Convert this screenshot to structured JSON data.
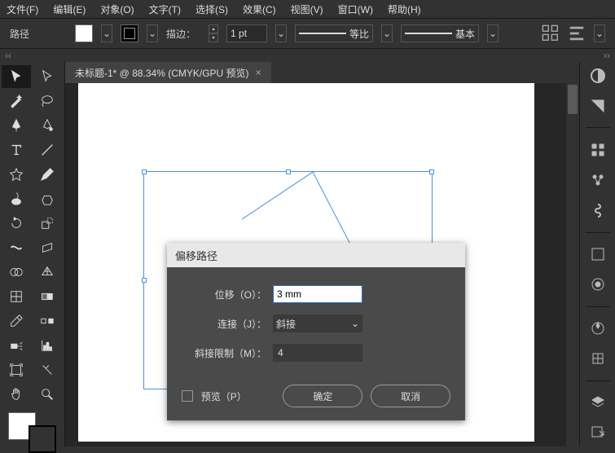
{
  "menu": {
    "file": "文件(F)",
    "edit": "编辑(E)",
    "object": "对象(O)",
    "type": "文字(T)",
    "select": "选择(S)",
    "effect": "效果(C)",
    "view": "视图(V)",
    "window": "窗口(W)",
    "help": "帮助(H)"
  },
  "options": {
    "pathLabel": "路径",
    "strokeLabel": "描边：",
    "strokeValue": "1 pt",
    "style1": "等比",
    "style2": "基本"
  },
  "document": {
    "tabTitle": "未标题-1* @ 88.34% (CMYK/GPU 预览)"
  },
  "dialog": {
    "title": "偏移路径",
    "offsetLabel": "位移（O）：",
    "offsetValue": "3 mm",
    "joinLabel": "连接（J）：",
    "joinValue": "斜接",
    "miterLabel": "斜接限制（M）：",
    "miterValue": "4",
    "previewLabel": "预览（P）",
    "ok": "确定",
    "cancel": "取消"
  }
}
